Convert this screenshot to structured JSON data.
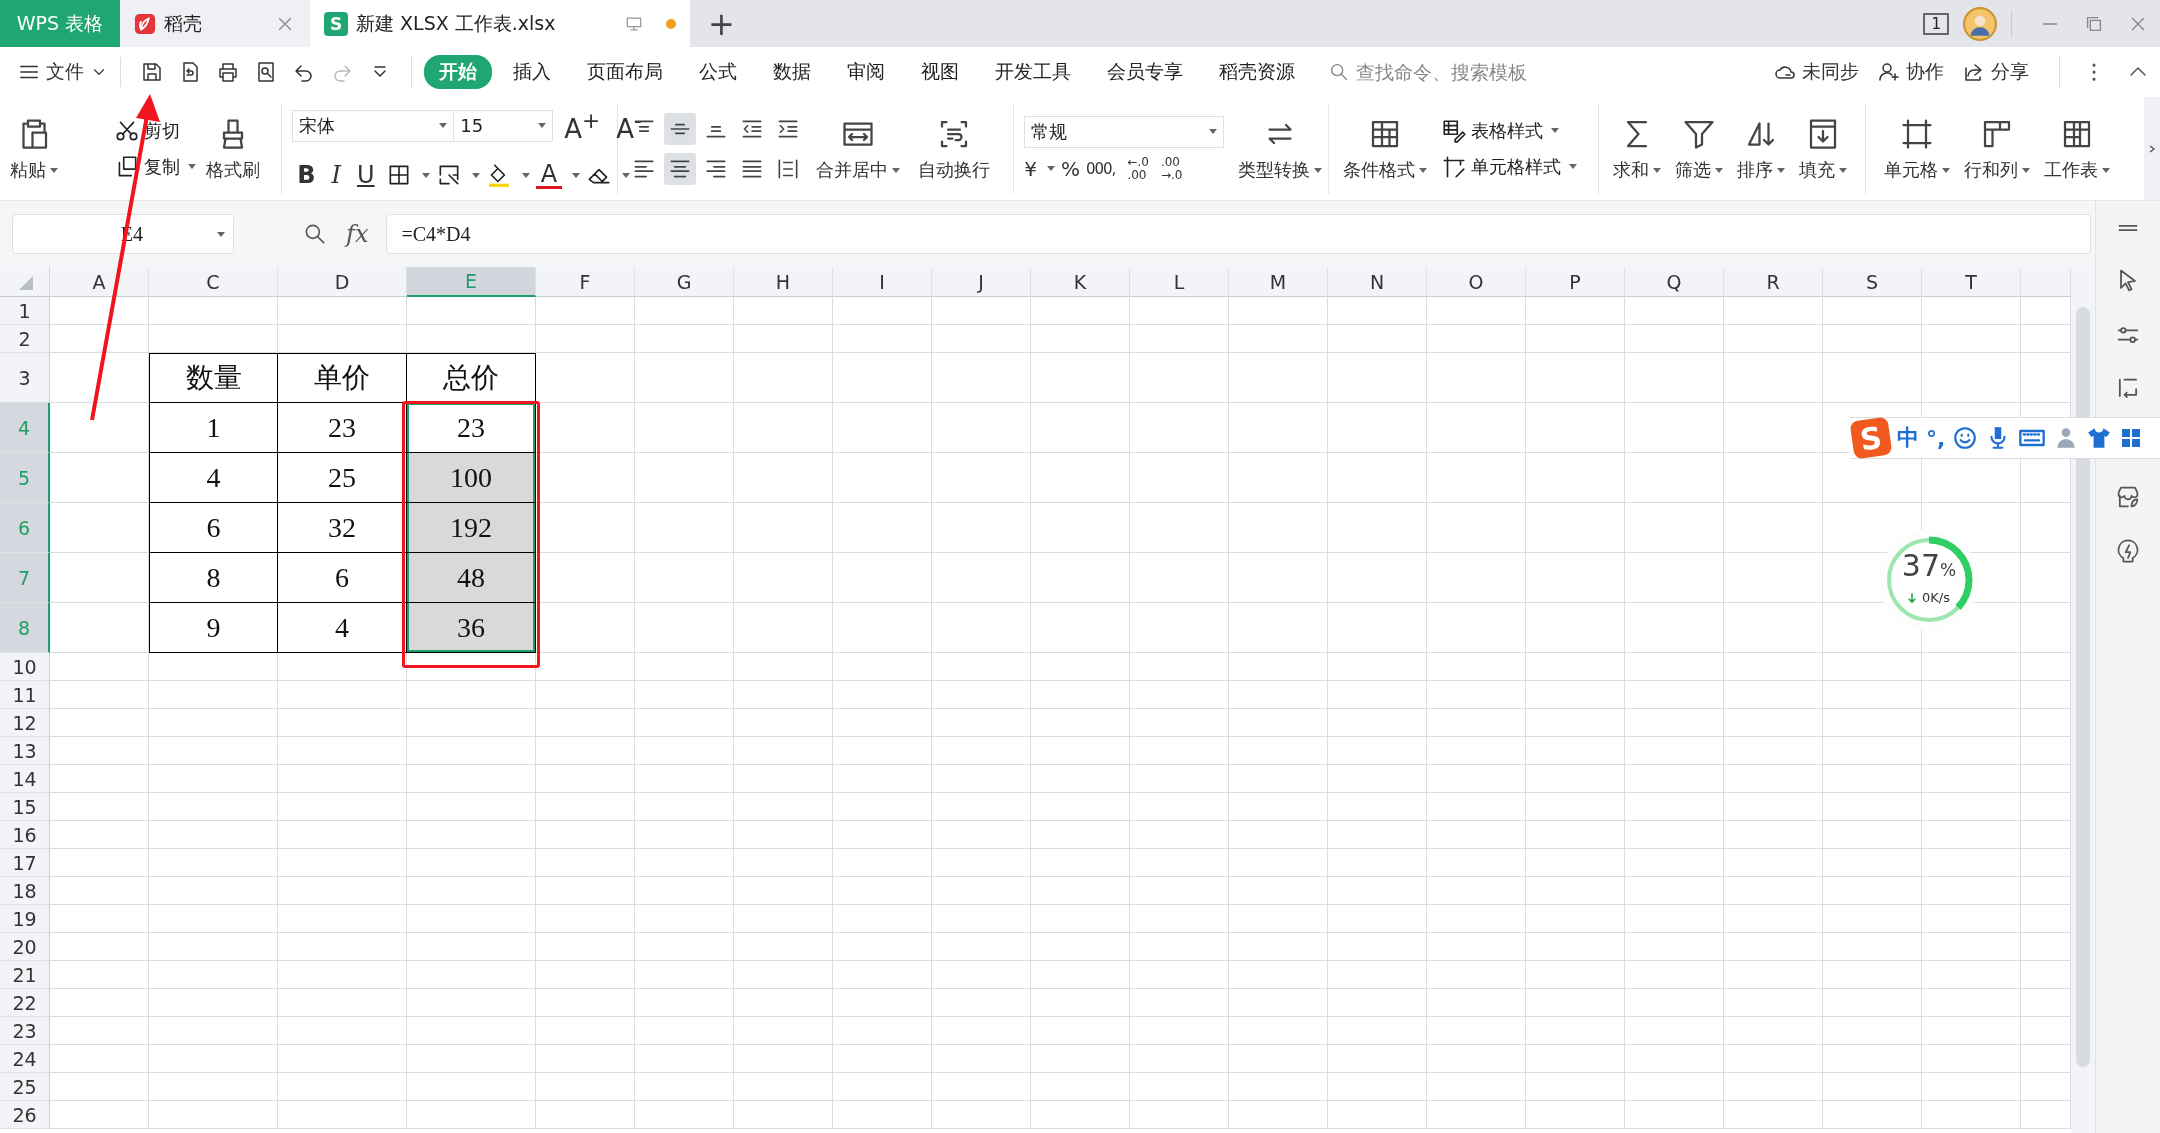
{
  "tab_bar": {
    "app_tab": "WPS 表格",
    "tabs": [
      {
        "kind": "docer",
        "label": "稻壳",
        "selected": false
      },
      {
        "kind": "sheet",
        "logo": "S",
        "label": "新建 XLSX 工作表.xlsx",
        "selected": true,
        "modified": true
      }
    ],
    "new_tab": "+",
    "window_count": "1"
  },
  "menu_bar": {
    "file_menu": "文件",
    "quick_access": [
      {
        "kind": "save",
        "disabled": false
      },
      {
        "kind": "export",
        "disabled": false
      },
      {
        "kind": "print",
        "disabled": false
      },
      {
        "kind": "preview",
        "disabled": false
      },
      {
        "kind": "undo",
        "disabled": false
      },
      {
        "kind": "redo",
        "disabled": true
      },
      {
        "kind": "customize",
        "disabled": false
      }
    ],
    "ribbon_tabs": [
      {
        "label": "开始",
        "selected": true
      },
      {
        "label": "插入",
        "selected": false
      },
      {
        "label": "页面布局",
        "selected": false
      },
      {
        "label": "公式",
        "selected": false
      },
      {
        "label": "数据",
        "selected": false
      },
      {
        "label": "审阅",
        "selected": false
      },
      {
        "label": "视图",
        "selected": false
      },
      {
        "label": "开发工具",
        "selected": false
      },
      {
        "label": "会员专享",
        "selected": false
      },
      {
        "label": "稻壳资源",
        "selected": false
      }
    ],
    "search": {
      "placeholder": "查找命令、搜索模板"
    },
    "actions": [
      {
        "kind": "sync",
        "label": "未同步"
      },
      {
        "kind": "collab",
        "label": "协作"
      },
      {
        "kind": "share",
        "label": "分享"
      }
    ]
  },
  "ribbon": {
    "clipboard": {
      "paste": "粘贴",
      "cut": "剪切",
      "copy": "复制",
      "format_painter": "格式刷"
    },
    "font": {
      "name": "宋体",
      "size": "15",
      "grow": "A$^{+}$",
      "shrink": "A$^{-}$",
      "bold": "B",
      "italic": "I",
      "underline": "U",
      "font_color": "A"
    },
    "alignment": {
      "buttons": [
        {
          "kind": "top",
          "selected": false
        },
        {
          "kind": "middle",
          "selected": true
        },
        {
          "kind": "bottom",
          "selected": false
        },
        {
          "kind": "outdent",
          "selected": false
        },
        {
          "kind": "indent",
          "selected": false
        },
        {
          "kind": "left",
          "selected": false
        },
        {
          "kind": "center",
          "selected": true
        },
        {
          "kind": "right",
          "selected": false
        },
        {
          "kind": "justify",
          "selected": false
        },
        {
          "kind": "distributed",
          "selected": false
        }
      ],
      "merge": "合并居中",
      "wrap": "自动换行"
    },
    "number": {
      "format": "常规",
      "currency": "¥",
      "percent": "%",
      "thousands": "000,",
      "decimals": [
        {
          "top": "←.0",
          "bottom": ".00"
        },
        {
          "top": ".00",
          "bottom": "→.0"
        }
      ],
      "convert": "类型转换"
    },
    "styles": {
      "conditional": "条件格式",
      "table_style": "表格样式",
      "cell_style": "单元格样式"
    },
    "editing": [
      {
        "kind": "sum",
        "label": "求和"
      },
      {
        "kind": "filter",
        "label": "筛选"
      },
      {
        "kind": "sort",
        "label": "排序"
      },
      {
        "kind": "fill",
        "label": "填充"
      },
      {
        "kind": "cells",
        "label": "单元格"
      },
      {
        "kind": "rowcol",
        "label": "行和列"
      },
      {
        "kind": "worksheet",
        "label": "工作表"
      }
    ]
  },
  "formula_bar": {
    "name_box": "E4",
    "fx": "fx",
    "formula": "=C4*D4"
  },
  "sheet": {
    "columns": [
      {
        "label": "A",
        "selected": false
      },
      {
        "label": "C",
        "selected": false
      },
      {
        "label": "D",
        "selected": false
      },
      {
        "label": "E",
        "selected": true
      },
      {
        "label": "F",
        "selected": false
      },
      {
        "label": "G",
        "selected": false
      },
      {
        "label": "H",
        "selected": false
      },
      {
        "label": "I",
        "selected": false
      },
      {
        "label": "J",
        "selected": false
      },
      {
        "label": "K",
        "selected": false
      },
      {
        "label": "L",
        "selected": false
      },
      {
        "label": "M",
        "selected": false
      },
      {
        "label": "N",
        "selected": false
      },
      {
        "label": "O",
        "selected": false
      },
      {
        "label": "P",
        "selected": false
      },
      {
        "label": "Q",
        "selected": false
      },
      {
        "label": "R",
        "selected": false
      },
      {
        "label": "S",
        "selected": false
      },
      {
        "label": "T",
        "selected": false
      }
    ],
    "rows": [
      {
        "label": "1",
        "selected": false
      },
      {
        "label": "2",
        "selected": false
      },
      {
        "label": "3",
        "selected": false
      },
      {
        "label": "4",
        "selected": true
      },
      {
        "label": "5",
        "selected": true
      },
      {
        "label": "6",
        "selected": true
      },
      {
        "label": "7",
        "selected": true
      },
      {
        "label": "8",
        "selected": true
      },
      {
        "label": "10",
        "selected": false
      },
      {
        "label": "11",
        "selected": false
      },
      {
        "label": "12",
        "selected": false
      },
      {
        "label": "13",
        "selected": false
      },
      {
        "label": "14",
        "selected": false
      },
      {
        "label": "15",
        "selected": false
      },
      {
        "label": "16",
        "selected": false
      },
      {
        "label": "17",
        "selected": false
      },
      {
        "label": "18",
        "selected": false
      },
      {
        "label": "19",
        "selected": false
      },
      {
        "label": "20",
        "selected": false
      },
      {
        "label": "21",
        "selected": false
      },
      {
        "label": "22",
        "selected": false
      },
      {
        "label": "23",
        "selected": false
      },
      {
        "label": "24",
        "selected": false
      },
      {
        "label": "25",
        "selected": false
      },
      {
        "label": "26",
        "selected": false
      }
    ],
    "table": [
      [
        {
          "text": "数量",
          "selected": false
        },
        {
          "text": "单价",
          "selected": false
        },
        {
          "text": "总价",
          "selected": false
        }
      ],
      [
        {
          "text": "1",
          "selected": false
        },
        {
          "text": "23",
          "selected": false
        },
        {
          "text": "23",
          "selected": true,
          "active": true
        }
      ],
      [
        {
          "text": "4",
          "selected": false
        },
        {
          "text": "25",
          "selected": false
        },
        {
          "text": "100",
          "selected": true
        }
      ],
      [
        {
          "text": "6",
          "selected": false
        },
        {
          "text": "32",
          "selected": false
        },
        {
          "text": "192",
          "selected": true
        }
      ],
      [
        {
          "text": "8",
          "selected": false
        },
        {
          "text": "6",
          "selected": false
        },
        {
          "text": "48",
          "selected": true
        }
      ],
      [
        {
          "text": "9",
          "selected": false
        },
        {
          "text": "4",
          "selected": false
        },
        {
          "text": "36",
          "selected": true
        }
      ]
    ]
  },
  "ime_toolbar": {
    "logo": "S",
    "mode": "中",
    "punctuation": "°,"
  },
  "speed_widget": {
    "level": 0.37,
    "value": "37",
    "unit": "%",
    "speed": "0K/s"
  }
}
